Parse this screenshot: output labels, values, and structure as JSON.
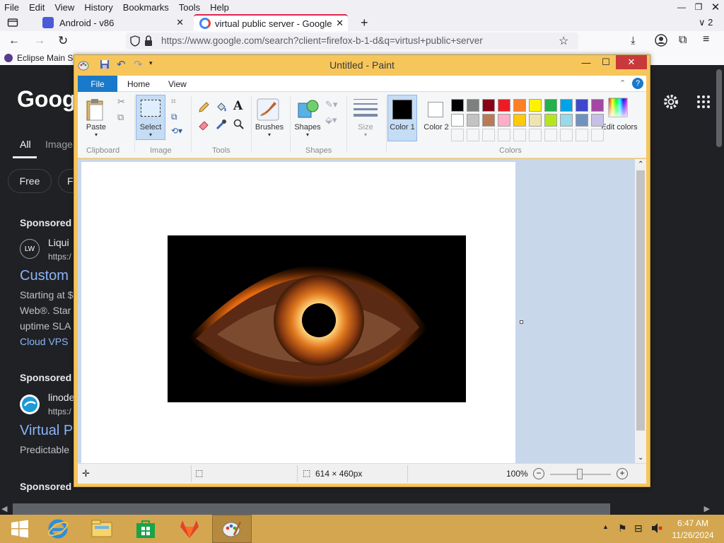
{
  "browser": {
    "menu": [
      "File",
      "Edit",
      "View",
      "History",
      "Bookmarks",
      "Tools",
      "Help"
    ],
    "tabs": [
      {
        "label": "Android - v86"
      },
      {
        "label": "virtual public server - Google Se"
      }
    ],
    "tab_count_label": "2",
    "url": "https://www.google.com/search?client=firefox-b-1-d&q=virtusl+public+server",
    "bookmark": "Eclipse Main S"
  },
  "google": {
    "logo": "Googl",
    "tabs": [
      "All",
      "Image"
    ],
    "chips": [
      "Free",
      "F"
    ],
    "sponsored": "Sponsored",
    "ad1": {
      "favicon": "LW",
      "name": "Liqui",
      "url": "https:/",
      "title": "Custom",
      "lines": [
        "Starting at $",
        "Web®. Star",
        "uptime SLA"
      ],
      "link": "Cloud VPS"
    },
    "ad2": {
      "name": "linode",
      "url": "https:/",
      "title": "Virtual P",
      "line": "Predictable"
    }
  },
  "paint": {
    "title": "Untitled - Paint",
    "ribbon_tabs": {
      "file": "File",
      "home": "Home",
      "view": "View"
    },
    "groups": {
      "clipboard": "Clipboard",
      "image": "Image",
      "tools": "Tools",
      "shapes": "Shapes",
      "colors": "Colors"
    },
    "buttons": {
      "paste": "Paste",
      "select": "Select",
      "brushes": "Brushes",
      "shapes": "Shapes",
      "size": "Size",
      "color1": "Color 1",
      "color2": "Color 2",
      "edit_colors": "Edit colors"
    },
    "text_tool": "A",
    "color1": "#000000",
    "color2": "#ffffff",
    "palette_row1": [
      "#000000",
      "#7f7f7f",
      "#880015",
      "#ed1c24",
      "#ff7f27",
      "#fff200",
      "#22b14c",
      "#00a2e8",
      "#3f48cc",
      "#a349a4"
    ],
    "palette_row2": [
      "#ffffff",
      "#c3c3c3",
      "#b97a57",
      "#ffaec9",
      "#ffc90e",
      "#efe4b0",
      "#b5e61d",
      "#99d9ea",
      "#7092be",
      "#c8bfe7"
    ],
    "image_size": "614 × 460px",
    "zoom": "100%"
  },
  "taskbar": {
    "time": "6:47 AM",
    "date": "11/26/2024"
  }
}
